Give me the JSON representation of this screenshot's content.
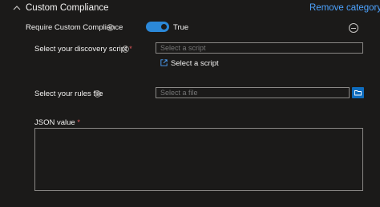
{
  "section": {
    "title": "Custom Compliance",
    "remove_label": "Remove category"
  },
  "require_compliance": {
    "label": "Require Custom Compliance",
    "state_label": "True",
    "enabled": true
  },
  "discovery_script": {
    "label": "Select your discovery script",
    "required_mark": "*",
    "placeholder": "Select a script",
    "value": "",
    "link_label": "Select a script"
  },
  "rules_file": {
    "label": "Select your rules file",
    "placeholder": "Select a file",
    "value": ""
  },
  "json_value": {
    "label": "JSON value",
    "required_mark": "*",
    "value": ""
  },
  "colors": {
    "background": "#1b1a19",
    "accent": "#2b88d8",
    "link": "#4da3ff",
    "border": "#8a8886",
    "required": "#e8595c",
    "browse_button": "#0f6cbd"
  },
  "icons": [
    "chevron-up-icon",
    "info-icon",
    "remove-circle-icon",
    "external-link-icon",
    "folder-icon"
  ]
}
